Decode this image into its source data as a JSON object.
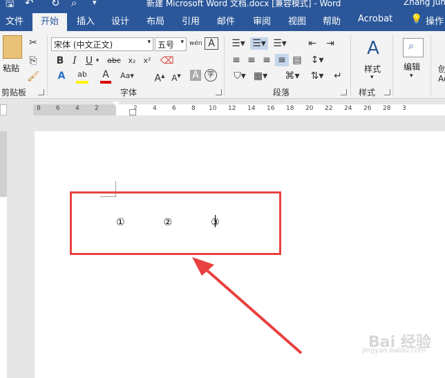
{
  "titlebar": {
    "title": "新建 Microsoft Word 文档.docx [兼容模式] - Word",
    "user": "Zhang Jun"
  },
  "tabs": [
    "文件",
    "开始",
    "插入",
    "设计",
    "布局",
    "引用",
    "邮件",
    "审阅",
    "视图",
    "帮助",
    "Acrobat",
    "操作"
  ],
  "active_tab": "开始",
  "ribbon": {
    "clipboard": {
      "paste_label": "粘贴",
      "group_label": "剪贴板"
    },
    "font": {
      "font_name": "宋体 (中文正文)",
      "font_size": "五号",
      "group_label": "字体"
    },
    "paragraph": {
      "group_label": "段落"
    },
    "styles": {
      "button_label": "样式",
      "group_label": "样式"
    },
    "editing": {
      "button_label": "编辑"
    },
    "create": {
      "label": "创",
      "label2": "Ad"
    }
  },
  "ruler": {
    "numbers": [
      "8",
      "6",
      "4",
      "2",
      "2",
      "4",
      "6",
      "8",
      "10",
      "12",
      "14",
      "16",
      "18",
      "20",
      "22",
      "24",
      "26",
      "28",
      "3"
    ]
  },
  "document": {
    "text": "①　　　　②　　　　③"
  },
  "watermark": {
    "brand": "Bai 经验",
    "url": "jingyan.baidu.com"
  },
  "colors": {
    "title_blue": "#2b579a",
    "annotation_red": "#e8413f"
  }
}
